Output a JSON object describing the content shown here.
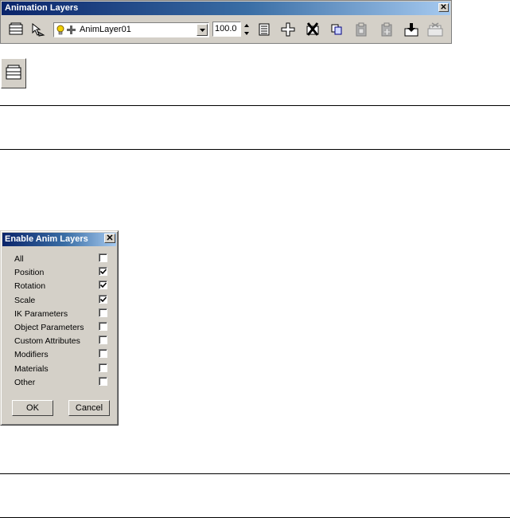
{
  "toolbar": {
    "title": "Animation Layers",
    "close_symbol": "✕",
    "layer_name": "AnimLayer01",
    "weight": "100.0",
    "icons": [
      "enable-anim-layers-icon",
      "select-active-layer-objects-icon",
      "layer-light-bulb-icon",
      "layer-plus-icon",
      "combo-dropdown-icon",
      "spinner-up-icon",
      "spinner-down-icon",
      "layer-properties-icon",
      "add-anim-layer-icon",
      "delete-anim-layer-icon",
      "copy-anim-layer-icon",
      "paste-active-icon",
      "paste-new-icon",
      "collapse-layer-icon",
      "disable-anim-layer-icon"
    ]
  },
  "dialog": {
    "title": "Enable Anim Layers",
    "close_symbol": "✕",
    "options": [
      {
        "label": "All",
        "checked": false
      },
      {
        "label": "Position",
        "checked": true
      },
      {
        "label": "Rotation",
        "checked": true
      },
      {
        "label": "Scale",
        "checked": true
      },
      {
        "label": "IK Parameters",
        "checked": false
      },
      {
        "label": "Object Parameters",
        "checked": false
      },
      {
        "label": "Custom Attributes",
        "checked": false
      },
      {
        "label": "Modifiers",
        "checked": false
      },
      {
        "label": "Materials",
        "checked": false
      },
      {
        "label": "Other",
        "checked": false
      }
    ],
    "ok_label": "OK",
    "cancel_label": "Cancel"
  },
  "colors": {
    "title_gradient_start": "#0a246a",
    "title_gradient_end": "#a6caf0",
    "face": "#d4d0c8",
    "bulb_yellow": "#f0d000"
  }
}
